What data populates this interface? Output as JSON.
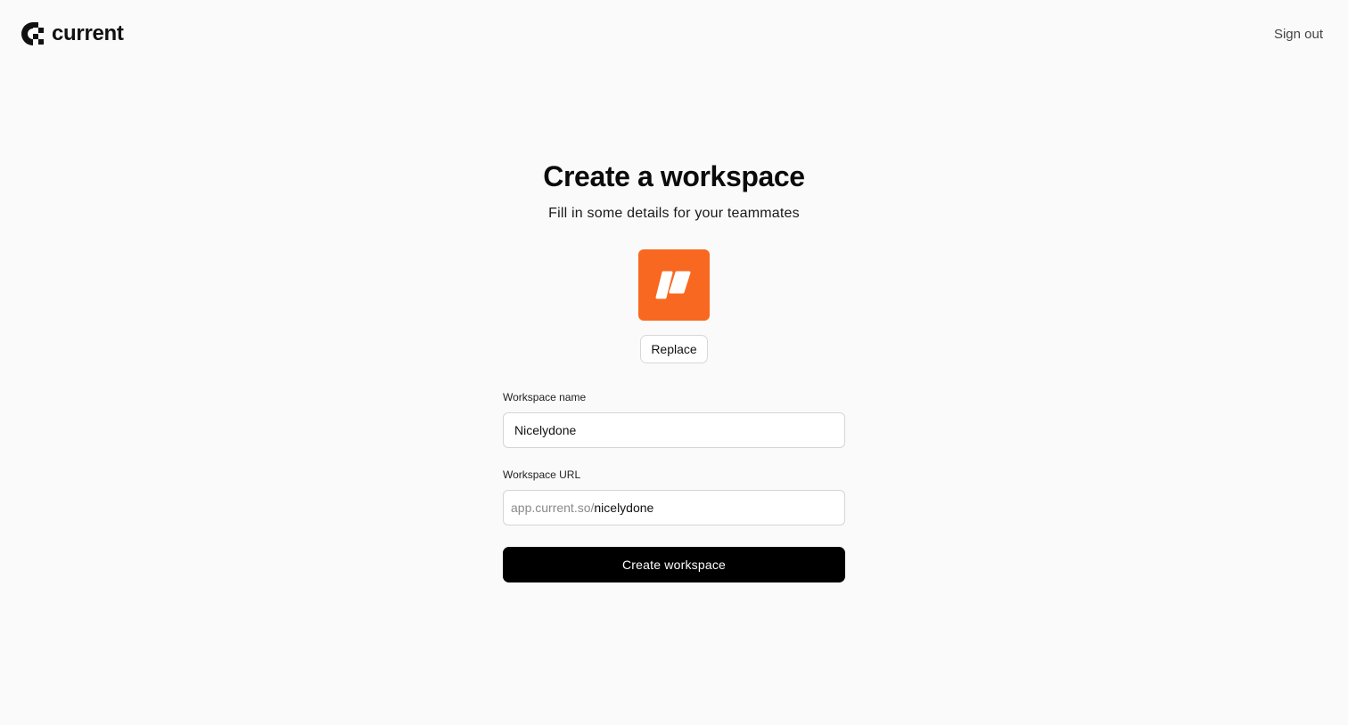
{
  "brand": {
    "name": "current",
    "logo_icon": "current-logo-icon"
  },
  "header": {
    "sign_out_label": "Sign out"
  },
  "main": {
    "title": "Create a workspace",
    "subtitle": "Fill in some details for your teammates",
    "workspace_logo": {
      "icon": "workspace-logo-icon",
      "color": "#f96820"
    },
    "replace_label": "Replace"
  },
  "form": {
    "name_label": "Workspace name",
    "name_value": "Nicelydone",
    "url_label": "Workspace URL",
    "url_prefix": "app.current.so/",
    "url_value": "nicelydone",
    "submit_label": "Create workspace"
  }
}
